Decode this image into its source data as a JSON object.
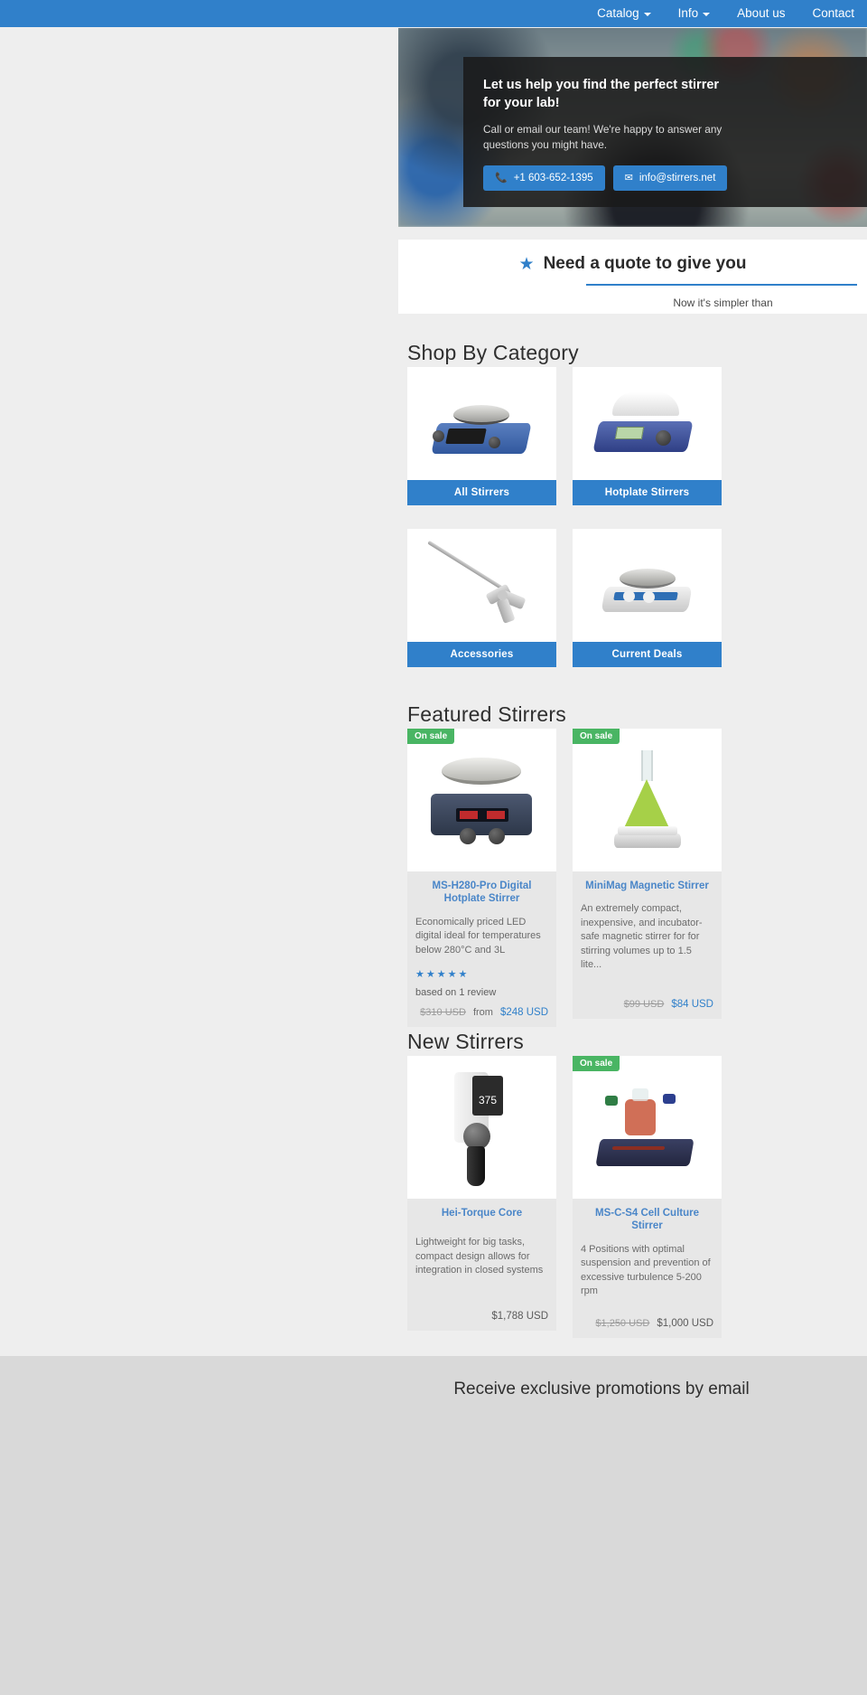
{
  "nav": {
    "items": [
      {
        "label": "Catalog",
        "has_caret": true
      },
      {
        "label": "Info",
        "has_caret": true
      },
      {
        "label": "About us",
        "has_caret": false
      },
      {
        "label": "Contact",
        "has_caret": false
      }
    ]
  },
  "hero": {
    "headline": "Let us help you find the perfect stirrer for your lab!",
    "subtext": "Call or email our team! We're happy to answer any questions you might have.",
    "phone_icon": "phone-icon",
    "phone_label": "+1 603-652-1395",
    "email_icon": "envelope-icon",
    "email_label": "info@stirrers.net"
  },
  "quote_banner": {
    "star_icon": "star-icon",
    "title": "Need a quote to give you",
    "subtitle": "Now it's simpler than"
  },
  "categories": {
    "heading": "Shop By Category",
    "items": [
      {
        "label": "All Stirrers",
        "art": "hotplate-blue"
      },
      {
        "label": "Hotplate Stirrers",
        "art": "hotplate-white"
      },
      {
        "label": "Accessories",
        "art": "impeller-shaft"
      },
      {
        "label": "Current Deals",
        "art": "magnetic-grey"
      }
    ]
  },
  "featured": {
    "heading": "Featured Stirrers",
    "products": [
      {
        "badge": "On sale",
        "title": "MS-H280-Pro Digital Hotplate Stirrer",
        "description": "Economically priced LED digital ideal for temperatures below 280°C and 3L",
        "stars": "★★★★★",
        "rating_text": "based on 1 review",
        "price_old": "$310 USD",
        "price_prefix": "from",
        "price_new": "$248 USD",
        "art": "hotplate-dark"
      },
      {
        "badge": "On sale",
        "title": "MiniMag Magnetic Stirrer",
        "description": "An extremely compact, inexpensive, and incubator-safe magnetic stirrer for for stirring volumes up to 1.5 lite...",
        "stars": "",
        "rating_text": "",
        "price_old": "$99 USD",
        "price_prefix": "",
        "price_new": "$84 USD",
        "art": "flask-green"
      }
    ]
  },
  "new_stirrers": {
    "heading": "New Stirrers",
    "products": [
      {
        "badge": "",
        "title": "Hei-Torque Core",
        "description": "Lightweight for big tasks, compact design allows for integration in closed systems",
        "price_old": "",
        "price_prefix": "",
        "price_new": "$1,788 USD",
        "art": "overhead-stirrer"
      },
      {
        "badge": "On sale",
        "title": "MS-C-S4 Cell Culture Stirrer",
        "description": "4 Positions with optimal suspension and prevention of excessive turbulence 5-200 rpm",
        "price_old": "$1,250 USD",
        "price_prefix": "",
        "price_new": "$1,000 USD",
        "art": "cell-culture"
      }
    ]
  },
  "footer": {
    "title": "Receive exclusive promotions by email"
  },
  "colors": {
    "brand_blue": "#3080ca",
    "sale_green": "#49b563",
    "page_bg": "#eeeeee",
    "footer_bg": "#d9d9d9",
    "card_bg": "#e7e7e7"
  }
}
